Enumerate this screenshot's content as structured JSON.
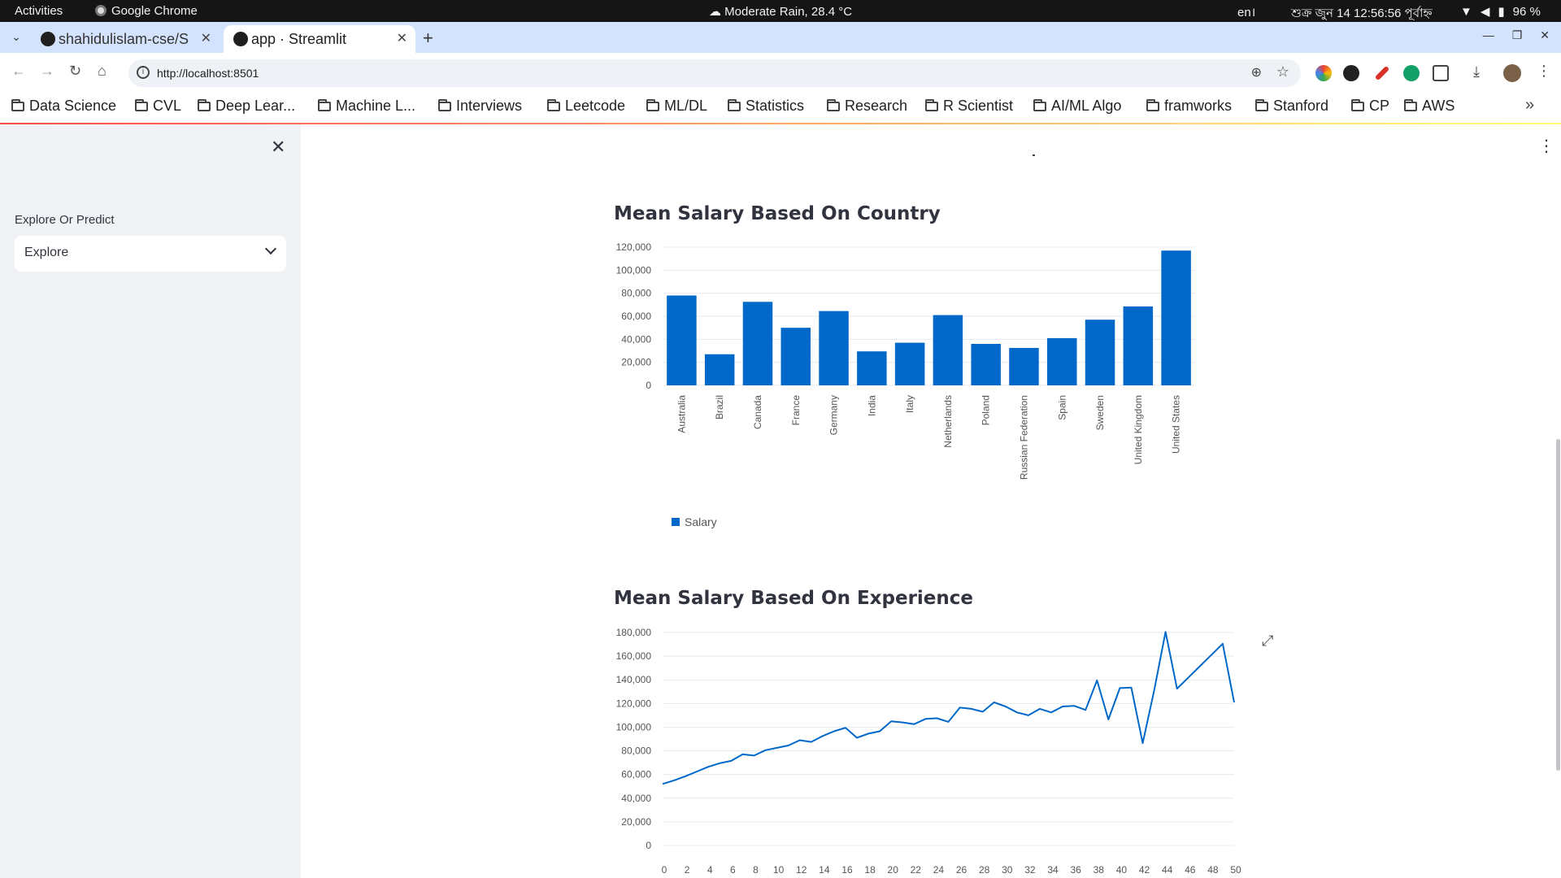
{
  "os_bar": {
    "activities": "Activities",
    "app_name": "Google Chrome",
    "weather": "Moderate Rain, 28.4 °C",
    "language": "en।",
    "clock": "শুক্র জুন 14  12:56:56 পূর্বাহ্ন",
    "battery": "96 %"
  },
  "tabs": [
    {
      "title": "shahidulislam-cse/S"
    },
    {
      "title": "app · Streamlit"
    }
  ],
  "address_bar": {
    "url": "http://localhost:8501"
  },
  "bookmarks": [
    "Data Science",
    "CVL",
    "Deep Lear...",
    "Machine L...",
    "Interviews",
    "Leetcode",
    "ML/DL",
    "Statistics",
    "Research",
    "R Scientist",
    "AI/ML Algo",
    "framworks",
    "Stanford",
    "CP",
    "AWS"
  ],
  "sidebar": {
    "select_label": "Explore Or Predict",
    "select_value": "Explore"
  },
  "colors": {
    "bar": "#0068c9",
    "line": "#0068c9",
    "sidebar_bg": "#f0f2f6"
  },
  "chart_data": [
    {
      "type": "bar",
      "title": "Mean Salary Based On Country",
      "categories": [
        "Australia",
        "Brazil",
        "Canada",
        "France",
        "Germany",
        "India",
        "Italy",
        "Netherlands",
        "Poland",
        "Russian Federation",
        "Spain",
        "Sweden",
        "United Kingdom",
        "United States"
      ],
      "values": [
        78000,
        27000,
        72500,
        50000,
        64500,
        29500,
        37000,
        61000,
        36000,
        32500,
        41000,
        57000,
        68500,
        117000
      ],
      "ylim": [
        0,
        120000
      ],
      "yticks": [
        0,
        20000,
        40000,
        60000,
        80000,
        100000,
        120000
      ],
      "ytick_labels": [
        "0",
        "20,000",
        "40,000",
        "60,000",
        "80,000",
        "100,000",
        "120,000"
      ],
      "legend": [
        "Salary"
      ],
      "legend_position": "bottom-left",
      "grid": true
    },
    {
      "type": "line",
      "title": "Mean Salary Based On Experience",
      "x": [
        0,
        1,
        2,
        3,
        4,
        5,
        6,
        7,
        8,
        9,
        10,
        11,
        12,
        13,
        14,
        15,
        16,
        17,
        18,
        19,
        20,
        21,
        22,
        23,
        24,
        25,
        26,
        27,
        28,
        29,
        30,
        31,
        32,
        33,
        34,
        35,
        36,
        37,
        38,
        39,
        40,
        41,
        42,
        43,
        44,
        45,
        46,
        47,
        48,
        49,
        50
      ],
      "values": [
        52000,
        55000,
        58500,
        62500,
        66500,
        69500,
        71500,
        77000,
        76000,
        80500,
        82500,
        84500,
        89000,
        87500,
        92500,
        96500,
        99500,
        91000,
        94500,
        96500,
        105000,
        104000,
        102500,
        107000,
        107500,
        104500,
        116500,
        115500,
        113000,
        121000,
        117500,
        112500,
        110000,
        115500,
        112500,
        117500,
        118000,
        114500,
        139500,
        106500,
        133000,
        133500,
        86500,
        131000,
        180500,
        132500,
        142000,
        151500,
        161000,
        170500,
        121000
      ],
      "ylim": [
        0,
        180000
      ],
      "yticks": [
        0,
        20000,
        40000,
        60000,
        80000,
        100000,
        120000,
        140000,
        160000,
        180000
      ],
      "ytick_labels": [
        "0",
        "20,000",
        "40,000",
        "60,000",
        "80,000",
        "100,000",
        "120,000",
        "140,000",
        "160,000",
        "180,000"
      ],
      "xticks": [
        0,
        2,
        4,
        6,
        8,
        10,
        12,
        14,
        16,
        18,
        20,
        22,
        24,
        26,
        28,
        30,
        32,
        34,
        36,
        38,
        40,
        42,
        44,
        46,
        48,
        50
      ],
      "grid": true
    }
  ]
}
